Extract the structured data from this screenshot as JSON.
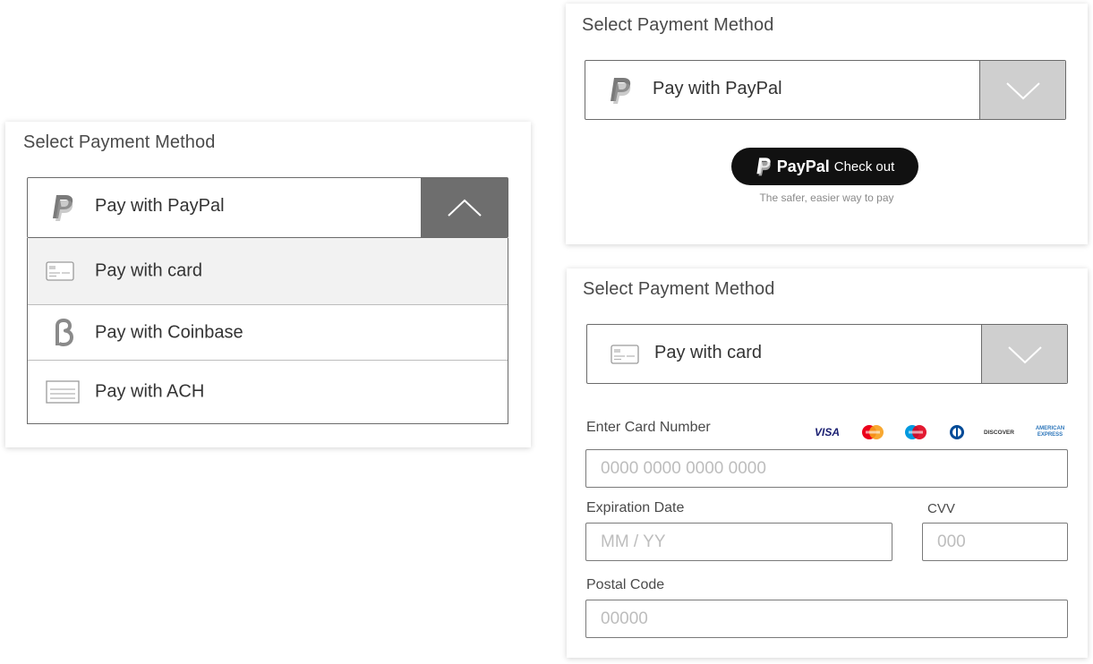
{
  "colors": {
    "toggle_open_bg": "#6e6e6e",
    "toggle_closed_bg": "#cfcfcf",
    "highlight_row": "#f2f2f2",
    "paypal_button": "#111111"
  },
  "left_panel": {
    "title": "Select Payment Method",
    "selected_label": "Pay with PayPal",
    "selected_icon": "paypal-icon",
    "toggle_icon": "chevron-up-icon",
    "options": [
      {
        "label": "Pay with card",
        "icon": "credit-card-icon"
      },
      {
        "label": "Pay with Coinbase",
        "icon": "coinbase-icon"
      },
      {
        "label": "Pay with ACH",
        "icon": "bank-check-icon"
      }
    ]
  },
  "paypal_panel": {
    "title": "Select Payment Method",
    "selected_label": "Pay with PayPal",
    "selected_icon": "paypal-icon",
    "toggle_icon": "chevron-down-icon",
    "button_brand": "PayPal",
    "button_text": "Check out",
    "tagline": "The safer, easier way to pay"
  },
  "card_panel": {
    "title": "Select Payment Method",
    "selected_label": "Pay with card",
    "selected_icon": "credit-card-icon",
    "toggle_icon": "chevron-down-icon",
    "card_number_label": "Enter Card Number",
    "card_number_placeholder": "0000 0000 0000 0000",
    "brands": {
      "visa": "VISA",
      "discover": "DISCOVER",
      "amex": "AMERICAN EXPRESS"
    },
    "expiration_label": "Expiration Date",
    "expiration_placeholder": "MM / YY",
    "cvv_label": "CVV",
    "cvv_placeholder": "000",
    "postal_label": "Postal Code",
    "postal_placeholder": "00000"
  }
}
